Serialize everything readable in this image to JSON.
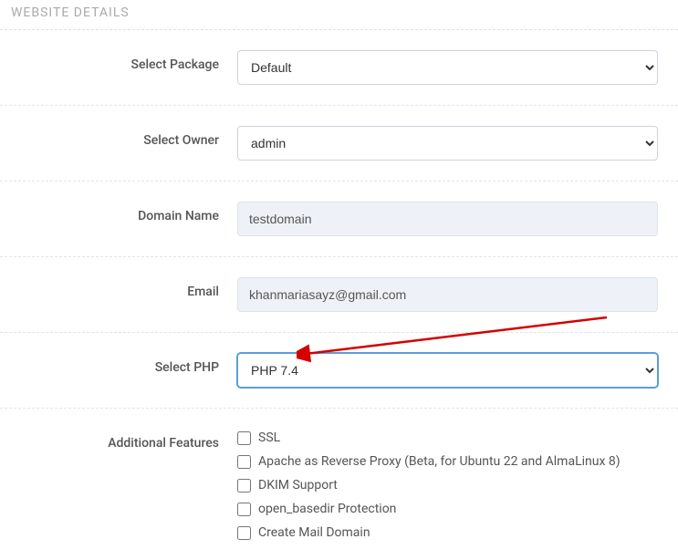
{
  "section_title": "WEBSITE DETAILS",
  "fields": {
    "package": {
      "label": "Select Package",
      "value": "Default"
    },
    "owner": {
      "label": "Select Owner",
      "value": "admin"
    },
    "domain": {
      "label": "Domain Name",
      "value": "testdomain"
    },
    "email": {
      "label": "Email",
      "value": "khanmariasayz@gmail.com"
    },
    "php": {
      "label": "Select PHP",
      "value": "PHP 7.4"
    },
    "additional": {
      "label": "Additional Features",
      "options": [
        "SSL",
        "Apache as Reverse Proxy (Beta, for Ubuntu 22 and AlmaLinux 8)",
        "DKIM Support",
        "open_basedir Protection",
        "Create Mail Domain"
      ]
    }
  }
}
